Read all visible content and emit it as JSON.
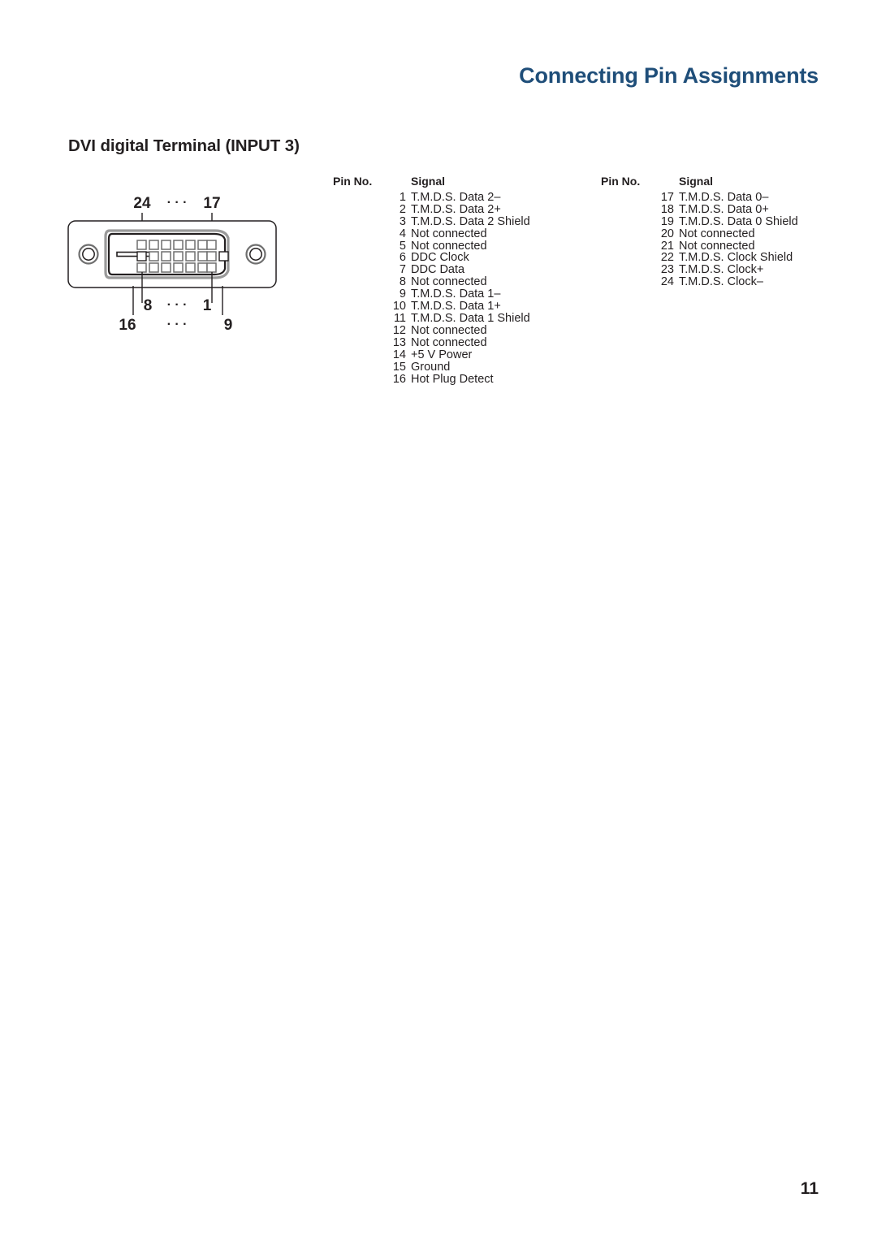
{
  "header": {
    "title": "Connecting Pin Assignments",
    "title_color": "#1f4e79"
  },
  "section": {
    "heading": "DVI digital Terminal (INPUT 3)"
  },
  "diagram": {
    "name": "dvi-connector-diagram",
    "labels": {
      "top_left": "24",
      "top_ellipsis": "· · ·",
      "top_right": "17",
      "mid_left": "8",
      "mid_ellipsis": "· · ·",
      "mid_right": "1",
      "bottom_left": "16",
      "bottom_ellipsis": "· · ·",
      "bottom_right": "9"
    },
    "pin_grid": {
      "rows": 3,
      "cols": 8,
      "total_pins": 24
    }
  },
  "tables": {
    "headers": {
      "pin": "Pin No.",
      "signal": "Signal"
    },
    "block_a": [
      {
        "pin": "1",
        "signal": "T.M.D.S. Data 2–"
      },
      {
        "pin": "2",
        "signal": "T.M.D.S. Data 2+"
      },
      {
        "pin": "3",
        "signal": "T.M.D.S. Data 2 Shield"
      },
      {
        "pin": "4",
        "signal": "Not connected"
      },
      {
        "pin": "5",
        "signal": "Not connected"
      },
      {
        "pin": "6",
        "signal": "DDC Clock"
      },
      {
        "pin": "7",
        "signal": "DDC Data"
      },
      {
        "pin": "8",
        "signal": "Not connected"
      },
      {
        "pin": "9",
        "signal": "T.M.D.S. Data 1–"
      },
      {
        "pin": "10",
        "signal": "T.M.D.S. Data 1+"
      },
      {
        "pin": "11",
        "signal": "T.M.D.S. Data 1 Shield"
      },
      {
        "pin": "12",
        "signal": "Not connected"
      },
      {
        "pin": "13",
        "signal": "Not connected"
      },
      {
        "pin": "14",
        "signal": "+5 V Power"
      },
      {
        "pin": "15",
        "signal": "Ground"
      },
      {
        "pin": "16",
        "signal": "Hot Plug Detect"
      }
    ],
    "block_b": [
      {
        "pin": "17",
        "signal": "T.M.D.S. Data 0–"
      },
      {
        "pin": "18",
        "signal": "T.M.D.S. Data 0+"
      },
      {
        "pin": "19",
        "signal": "T.M.D.S. Data 0 Shield"
      },
      {
        "pin": "20",
        "signal": "Not connected"
      },
      {
        "pin": "21",
        "signal": "Not connected"
      },
      {
        "pin": "22",
        "signal": "T.M.D.S. Clock Shield"
      },
      {
        "pin": "23",
        "signal": "T.M.D.S. Clock+"
      },
      {
        "pin": "24",
        "signal": "T.M.D.S. Clock–"
      }
    ]
  },
  "footer": {
    "page_number": "11"
  }
}
